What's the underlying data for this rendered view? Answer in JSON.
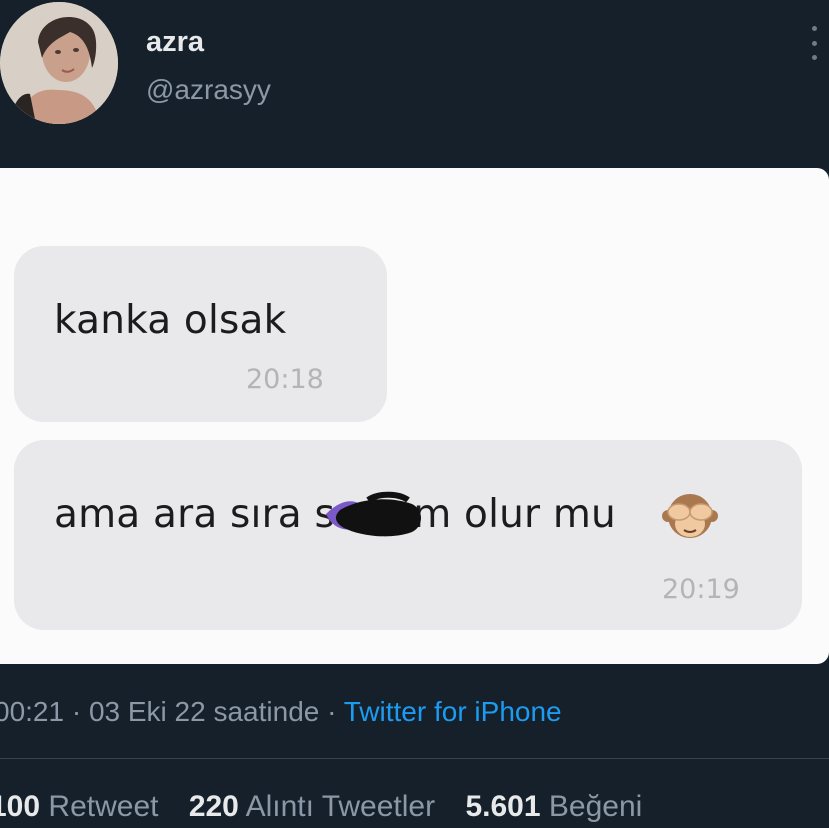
{
  "tweet": {
    "author": {
      "display_name": "azra",
      "handle": "@azrasyy"
    },
    "more_icon": "more-vertical-icon",
    "timestamp": "00:21 · 03 Eki 22 saatinde",
    "separator": " · ",
    "source": "Twitter for iPhone",
    "stats": {
      "retweets_count": "100",
      "retweets_label": "Retweet",
      "quotes_count": "220",
      "quotes_label": "Alıntı Tweetler",
      "likes_count": "5.601",
      "likes_label": "Beğeni"
    }
  },
  "chat": {
    "messages": [
      {
        "text": "kanka olsak",
        "time": "20:18"
      },
      {
        "text_before": "ama ara sıra s",
        "text_after": "em olur mu",
        "time": "20:19",
        "emoji": "see-no-evil-monkey-icon"
      }
    ]
  },
  "colors": {
    "background": "#15202b",
    "accent": "#1d9bf0",
    "bubble": "#e9e9eb",
    "scribble_purple": "#7b59c8"
  }
}
